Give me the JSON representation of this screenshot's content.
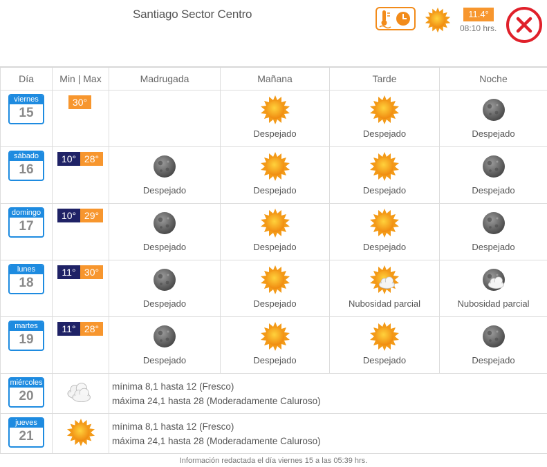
{
  "header": {
    "location": "Santiago Sector Centro",
    "current_temp": "11.4°",
    "current_time": "08:10 hrs.",
    "icons": [
      "thermometer-clock-icon",
      "sun-icon",
      "close-icon"
    ]
  },
  "table": {
    "headers": [
      "Día",
      "Min | Max",
      "Madrugada",
      "Mañana",
      "Tarde",
      "Noche"
    ],
    "rows": [
      {
        "day": "viernes",
        "date": "15",
        "min": "",
        "max": "30°",
        "madrugada": "",
        "manana": "Despejado",
        "tarde": "Despejado",
        "noche": "Despejado",
        "icons": [
          "none",
          "sun-icon",
          "sun-icon",
          "moon-icon"
        ]
      },
      {
        "day": "sábado",
        "date": "16",
        "min": "10°",
        "max": "28°",
        "madrugada": "Despejado",
        "manana": "Despejado",
        "tarde": "Despejado",
        "noche": "Despejado",
        "icons": [
          "moon-icon",
          "sun-icon",
          "sun-icon",
          "moon-icon"
        ]
      },
      {
        "day": "domingo",
        "date": "17",
        "min": "10°",
        "max": "29°",
        "madrugada": "Despejado",
        "manana": "Despejado",
        "tarde": "Despejado",
        "noche": "Despejado",
        "icons": [
          "moon-icon",
          "sun-icon",
          "sun-icon",
          "moon-icon"
        ]
      },
      {
        "day": "lunes",
        "date": "18",
        "min": "11°",
        "max": "30°",
        "madrugada": "Despejado",
        "manana": "Despejado",
        "tarde": "Nubosidad parcial",
        "noche": "Nubosidad parcial",
        "icons": [
          "moon-icon",
          "sun-icon",
          "sun-cloud-icon",
          "moon-cloud-icon"
        ]
      },
      {
        "day": "martes",
        "date": "19",
        "min": "11°",
        "max": "28°",
        "madrugada": "Despejado",
        "manana": "Despejado",
        "tarde": "Despejado",
        "noche": "Despejado",
        "icons": [
          "moon-icon",
          "sun-icon",
          "sun-icon",
          "moon-icon"
        ]
      }
    ],
    "extended": [
      {
        "day": "miércoles",
        "date": "20",
        "icon": "cloud-icon",
        "line1": "mínima 8,1 hasta 12 (Fresco)",
        "line2": "máxima 24,1 hasta 28 (Moderadamente Caluroso)"
      },
      {
        "day": "jueves",
        "date": "21",
        "icon": "sun-icon",
        "line1": "mínima 8,1 hasta 12 (Fresco)",
        "line2": "máxima 24,1 hasta 28 (Moderadamente Caluroso)"
      }
    ]
  },
  "footer": "Información redactada el día viernes 15 a las 05:39 hrs.",
  "colors": {
    "accent": "#f7962e",
    "calendar": "#1e8be0",
    "min_bg": "#1f2266",
    "close": "#e0202a"
  }
}
